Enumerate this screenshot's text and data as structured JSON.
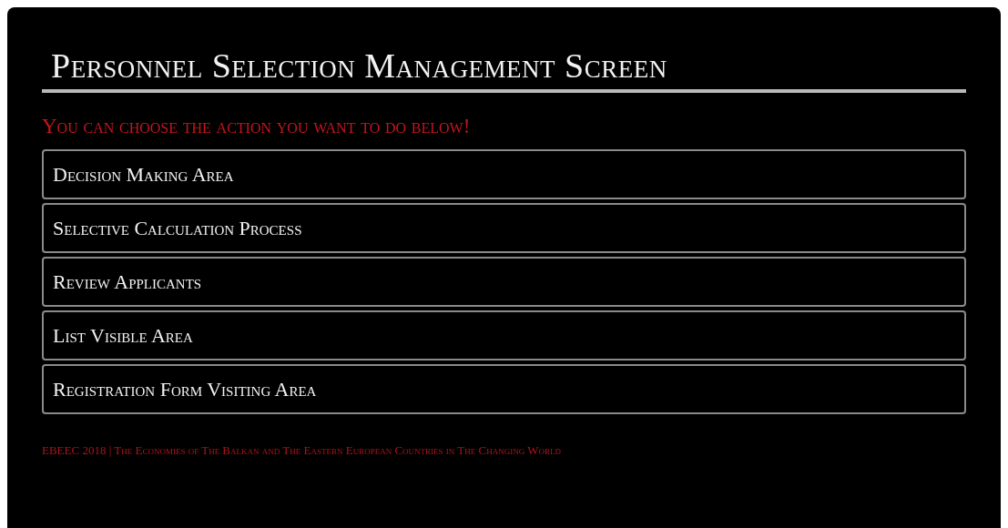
{
  "title": "Personnel Selection Management Screen",
  "subtitle": "You can choose the action you want to do below!",
  "actions": [
    {
      "label": "Decision Making Area"
    },
    {
      "label": "Selective Calculation Process"
    },
    {
      "label": "Review Applicants"
    },
    {
      "label": "List Visible Area"
    },
    {
      "label": "Registration Form Visiting Area"
    }
  ],
  "footer": "EBEEC 2018 | The Economies of The Balkan and The Eastern European Countries in The Changing World"
}
